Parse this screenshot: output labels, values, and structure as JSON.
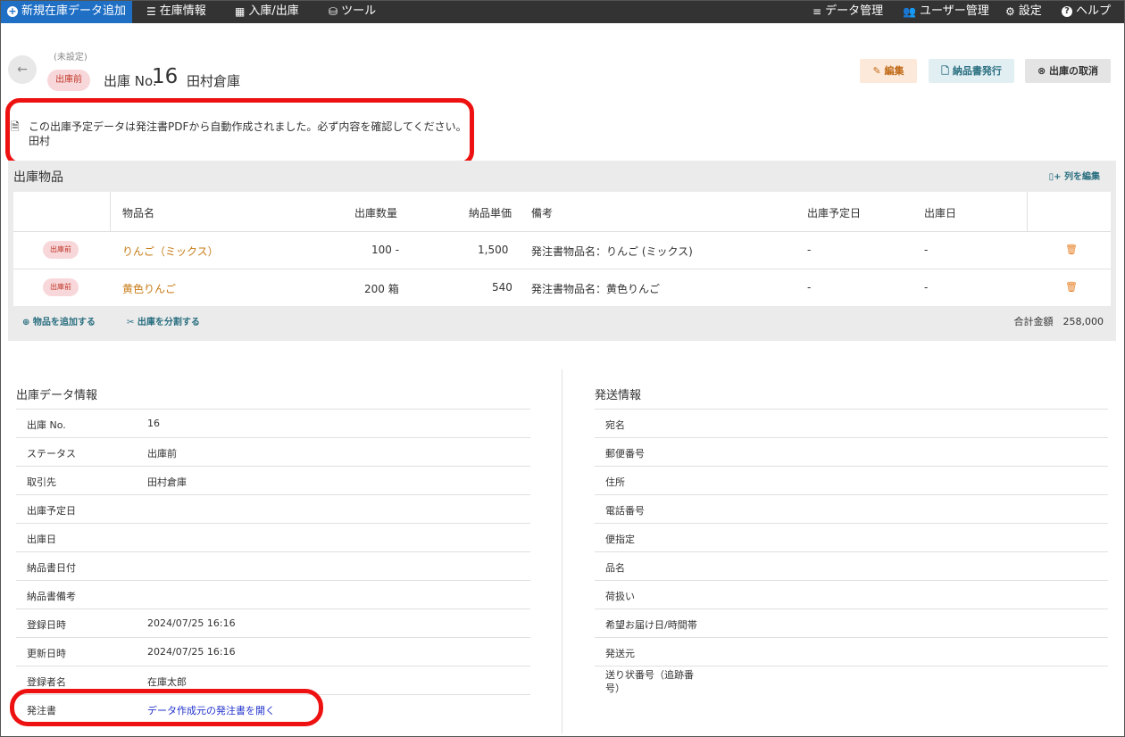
{
  "nav": {
    "new_outbound": "新規在庫データ追加",
    "inventory": "在庫情報",
    "inout": "入庫/出庫",
    "tools": "ツール",
    "data_mgmt": "データ管理",
    "user_mgmt": "ユーザー管理",
    "settings": "設定",
    "help": "ヘルプ"
  },
  "header": {
    "back_icon": "arrow-left-icon",
    "unset": "(未設定)",
    "status": "出庫前",
    "title_prefix": "出庫 No.",
    "number": "16",
    "partner": "田村倉庫",
    "edit": "編集",
    "issue_slip": "納品書発行",
    "cancel": "出庫の取消"
  },
  "notice": {
    "text": "この出庫予定データは発注書PDFから自動作成されました。必ず内容を確認してください。",
    "author": "田村"
  },
  "items": {
    "title": "出庫物品",
    "edit_columns": "列を編集",
    "columns": {
      "name": "物品名",
      "qty": "出庫数量",
      "price": "納品単価",
      "note": "備考",
      "planned": "出庫予定日",
      "date": "出庫日"
    },
    "rows": [
      {
        "status": "出庫前",
        "name": "りんご（ミックス）",
        "qty": "100 -",
        "price": "1,500",
        "note": "発注書物品名：りんご (ミックス)",
        "planned": "-",
        "date": "-"
      },
      {
        "status": "出庫前",
        "name": "黄色りんご",
        "qty": "200 箱",
        "price": "540",
        "note": "発注書物品名：黄色りんご",
        "planned": "-",
        "date": "-"
      }
    ],
    "add_item": "物品を追加する",
    "split": "出庫を分割する",
    "total": "合計金額　258,000"
  },
  "outbound_info": {
    "title": "出庫データ情報",
    "rows": [
      {
        "k": "出庫 No.",
        "v": "16"
      },
      {
        "k": "ステータス",
        "v": "出庫前"
      },
      {
        "k": "取引先",
        "v": "田村倉庫"
      },
      {
        "k": "出庫予定日",
        "v": ""
      },
      {
        "k": "出庫日",
        "v": ""
      },
      {
        "k": "納品書日付",
        "v": ""
      },
      {
        "k": "納品書備考",
        "v": ""
      },
      {
        "k": "登録日時",
        "v": "2024/07/25 16:16"
      },
      {
        "k": "更新日時",
        "v": "2024/07/25 16:16"
      },
      {
        "k": "登録者名",
        "v": "在庫太郎"
      },
      {
        "k": "発注書",
        "v": "データ作成元の発注書を開く"
      }
    ]
  },
  "shipping_info": {
    "title": "発送情報",
    "rows": [
      {
        "k": "宛名"
      },
      {
        "k": "郵便番号"
      },
      {
        "k": "住所"
      },
      {
        "k": "電話番号"
      },
      {
        "k": "便指定"
      },
      {
        "k": "品名"
      },
      {
        "k": "荷扱い"
      },
      {
        "k": "希望お届け日/時間帯"
      },
      {
        "k": "発送元"
      },
      {
        "k": "送り状番号（追跡番号）"
      }
    ]
  },
  "colors": {
    "nav_bg": "#333333",
    "primary": "#1f6fc5",
    "highlight": "#ee1111",
    "link": "#2233cc",
    "item_link": "#c77b16"
  }
}
